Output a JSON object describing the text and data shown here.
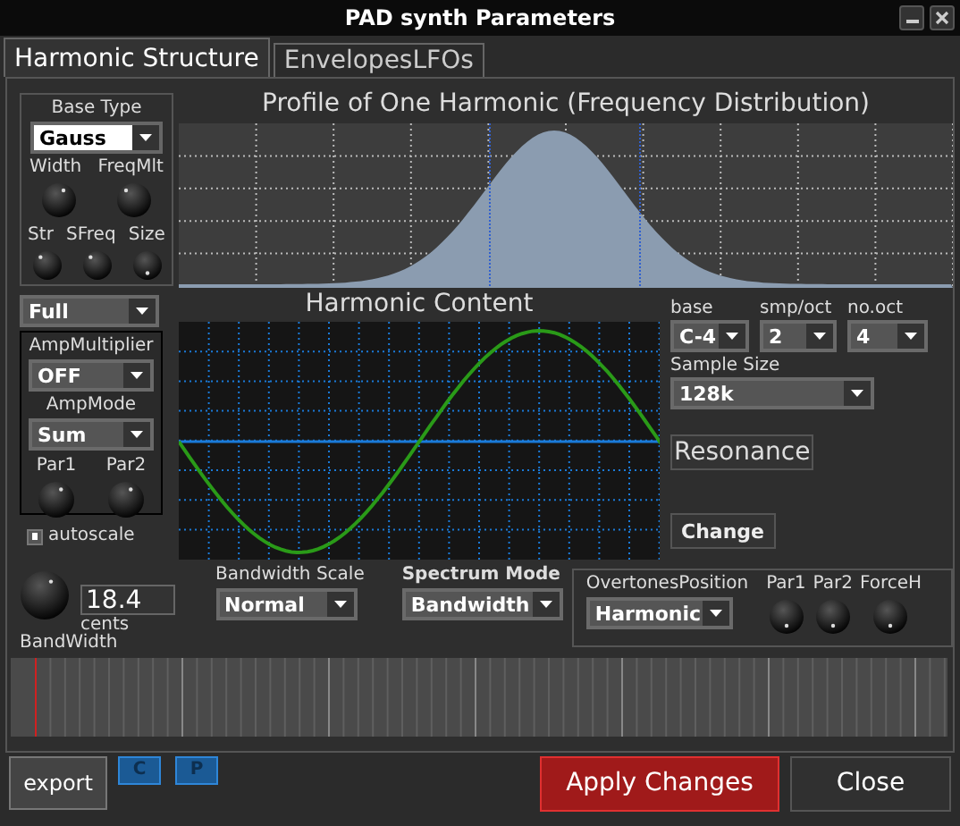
{
  "window": {
    "title": "PAD synth Parameters"
  },
  "tabs": [
    {
      "label": "Harmonic Structure",
      "selected": true
    },
    {
      "label": "EnvelopesLFOs",
      "selected": false
    }
  ],
  "base": {
    "label": "Base Type",
    "value": "Gauss",
    "knobs_row1": [
      "Width",
      "FreqMlt"
    ],
    "knobs_row2": [
      "Str",
      "SFreq",
      "Size"
    ]
  },
  "full": {
    "value": "Full"
  },
  "amp": {
    "multiplier_label": "AmpMultiplier",
    "multiplier": "OFF",
    "mode_label": "AmpMode",
    "mode": "Sum",
    "knobs": [
      "Par1",
      "Par2"
    ]
  },
  "autoscale": {
    "label": "autoscale",
    "checked": true
  },
  "profile": {
    "title": "Profile of One Harmonic (Frequency Distribution)"
  },
  "harmonic_content": {
    "title": "Harmonic Content"
  },
  "sampling": {
    "base_label": "base",
    "base": "C-4",
    "smp_label": "smp/oct",
    "smp": "2",
    "oct_label": "no.oct",
    "oct": "4",
    "size_label": "Sample Size",
    "size": "128k"
  },
  "resonance_button": "Resonance",
  "change_button": "Change",
  "bandwidth": {
    "value": "18.4",
    "unit": "cents",
    "label": "BandWidth"
  },
  "bandwidth_scale": {
    "label": "Bandwidth Scale",
    "value": "Normal"
  },
  "spectrum_mode": {
    "label": "Spectrum Mode",
    "value": "Bandwidth"
  },
  "overtones": {
    "label": "OvertonesPosition",
    "value": "Harmonic",
    "knobs": [
      "Par1",
      "Par2",
      "ForceH"
    ]
  },
  "footer": {
    "export": "export",
    "copy": "C",
    "paste": "P",
    "apply": "Apply Changes",
    "close": "Close"
  }
}
